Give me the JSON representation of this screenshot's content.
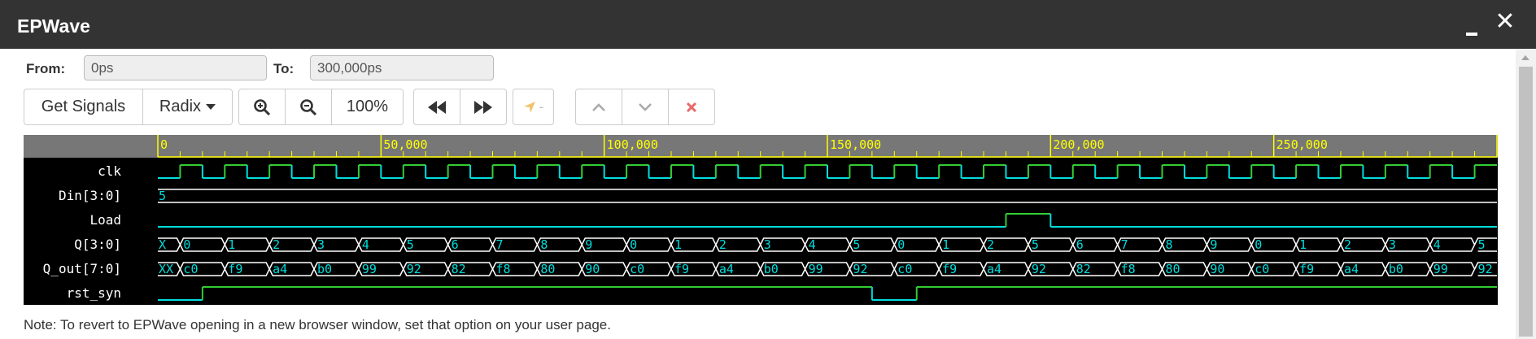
{
  "window": {
    "title": "EPWave"
  },
  "range": {
    "from_label": "From:",
    "from_value": "0ps",
    "to_label": "To:",
    "to_value": "300,000ps"
  },
  "toolbar": {
    "get_signals": "Get Signals",
    "radix": "Radix",
    "zoom_level": "100%",
    "marker_value": "-"
  },
  "ruler": {
    "labels": [
      "0",
      "50,000",
      "100,000",
      "150,000",
      "200,000",
      "250,000"
    ],
    "label_times": [
      0,
      50000,
      100000,
      150000,
      200000,
      250000
    ],
    "time_end": 300000
  },
  "signals": [
    {
      "name": "clk",
      "type": "clock",
      "period": 10000,
      "color_high": "#33cc33",
      "color_low": "#00dddd"
    },
    {
      "name": "Din[3:0]",
      "type": "bus",
      "segments": [
        {
          "t": 0,
          "v": "5"
        }
      ]
    },
    {
      "name": "Load",
      "type": "bit",
      "transitions": [
        {
          "t": 0,
          "v": 0
        },
        {
          "t": 190000,
          "v": 1
        },
        {
          "t": 200000,
          "v": 0
        }
      ]
    },
    {
      "name": "Q[3:0]",
      "type": "bus",
      "segments": [
        {
          "t": 0,
          "v": "X"
        },
        {
          "t": 5000,
          "v": "0"
        },
        {
          "t": 15000,
          "v": "1"
        },
        {
          "t": 25000,
          "v": "2"
        },
        {
          "t": 35000,
          "v": "3"
        },
        {
          "t": 45000,
          "v": "4"
        },
        {
          "t": 55000,
          "v": "5"
        },
        {
          "t": 65000,
          "v": "6"
        },
        {
          "t": 75000,
          "v": "7"
        },
        {
          "t": 85000,
          "v": "8"
        },
        {
          "t": 95000,
          "v": "9"
        },
        {
          "t": 105000,
          "v": "0"
        },
        {
          "t": 115000,
          "v": "1"
        },
        {
          "t": 125000,
          "v": "2"
        },
        {
          "t": 135000,
          "v": "3"
        },
        {
          "t": 145000,
          "v": "4"
        },
        {
          "t": 155000,
          "v": "5"
        },
        {
          "t": 165000,
          "v": "0"
        },
        {
          "t": 175000,
          "v": "1"
        },
        {
          "t": 185000,
          "v": "2"
        },
        {
          "t": 195000,
          "v": "5"
        },
        {
          "t": 205000,
          "v": "6"
        },
        {
          "t": 215000,
          "v": "7"
        },
        {
          "t": 225000,
          "v": "8"
        },
        {
          "t": 235000,
          "v": "9"
        },
        {
          "t": 245000,
          "v": "0"
        },
        {
          "t": 255000,
          "v": "1"
        },
        {
          "t": 265000,
          "v": "2"
        },
        {
          "t": 275000,
          "v": "3"
        },
        {
          "t": 285000,
          "v": "4"
        },
        {
          "t": 295000,
          "v": "5"
        }
      ]
    },
    {
      "name": "Q_out[7:0]",
      "type": "bus",
      "segments": [
        {
          "t": 0,
          "v": "XX"
        },
        {
          "t": 5000,
          "v": "c0"
        },
        {
          "t": 15000,
          "v": "f9"
        },
        {
          "t": 25000,
          "v": "a4"
        },
        {
          "t": 35000,
          "v": "b0"
        },
        {
          "t": 45000,
          "v": "99"
        },
        {
          "t": 55000,
          "v": "92"
        },
        {
          "t": 65000,
          "v": "82"
        },
        {
          "t": 75000,
          "v": "f8"
        },
        {
          "t": 85000,
          "v": "80"
        },
        {
          "t": 95000,
          "v": "90"
        },
        {
          "t": 105000,
          "v": "c0"
        },
        {
          "t": 115000,
          "v": "f9"
        },
        {
          "t": 125000,
          "v": "a4"
        },
        {
          "t": 135000,
          "v": "b0"
        },
        {
          "t": 145000,
          "v": "99"
        },
        {
          "t": 155000,
          "v": "92"
        },
        {
          "t": 165000,
          "v": "c0"
        },
        {
          "t": 175000,
          "v": "f9"
        },
        {
          "t": 185000,
          "v": "a4"
        },
        {
          "t": 195000,
          "v": "92"
        },
        {
          "t": 205000,
          "v": "82"
        },
        {
          "t": 215000,
          "v": "f8"
        },
        {
          "t": 225000,
          "v": "80"
        },
        {
          "t": 235000,
          "v": "90"
        },
        {
          "t": 245000,
          "v": "c0"
        },
        {
          "t": 255000,
          "v": "f9"
        },
        {
          "t": 265000,
          "v": "a4"
        },
        {
          "t": 275000,
          "v": "b0"
        },
        {
          "t": 285000,
          "v": "99"
        },
        {
          "t": 295000,
          "v": "92"
        }
      ]
    },
    {
      "name": "rst_syn",
      "type": "bit",
      "transitions": [
        {
          "t": 0,
          "v": 0
        },
        {
          "t": 10000,
          "v": 1
        },
        {
          "t": 160000,
          "v": 0
        },
        {
          "t": 170000,
          "v": 1
        }
      ]
    }
  ],
  "colors": {
    "high": "#33cc33",
    "low": "#00dddd",
    "bus_line": "#ffffff",
    "bus_text": "#00dddd",
    "ruler_line": "#ffff00",
    "ruler_bg": "#777777",
    "signal_name": "#ffffff"
  },
  "note": "Note: To revert to EPWave opening in a new browser window, set that option on your user page."
}
